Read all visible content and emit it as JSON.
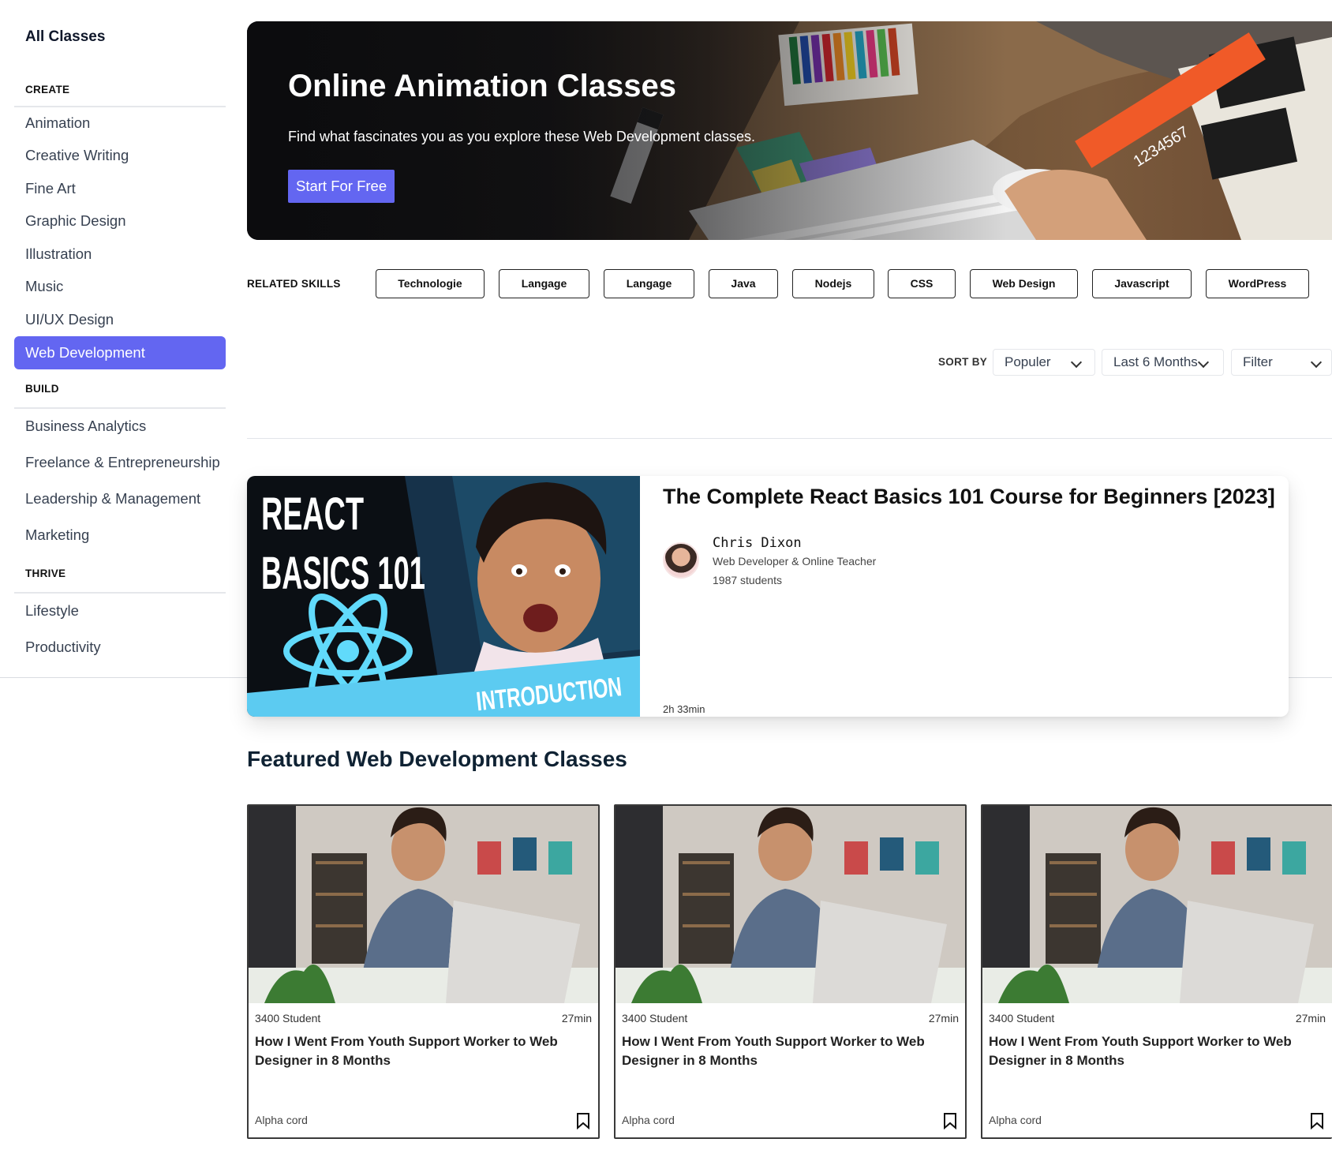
{
  "sidebar": {
    "title": "All Classes",
    "sections": {
      "create": "CREATE",
      "build": "BUILD",
      "thrive": "THRIVE"
    },
    "create_items": [
      "Animation",
      "Creative Writing",
      "Fine Art",
      "Graphic Design",
      "Illustration",
      "Music",
      "UI/UX Design",
      "Web Development"
    ],
    "build_items": [
      "Business Analytics",
      "Freelance & Entrepreneurship",
      "Leadership & Management",
      "Marketing"
    ],
    "thrive_items": [
      "Lifestyle",
      "Productivity"
    ],
    "active_item": "Web Development"
  },
  "hero": {
    "title": "Online Animation Classes",
    "subtitle": "Find what fascinates you as you explore these Web Development classes.",
    "button": "Start For Free",
    "ruler_text": "1234567"
  },
  "related_skills": {
    "label": "RELATED SKILLS",
    "chips": [
      "Technologie",
      "Langage",
      "Langage",
      "Java",
      "Nodejs",
      "CSS",
      "Web Design",
      "Javascript",
      "WordPress"
    ]
  },
  "sort": {
    "label": "SORT BY",
    "sort_value": "Populer",
    "period_value": "Last 6 Months",
    "filter_value": "Filter"
  },
  "featured_course": {
    "thumb_line1": "REACT",
    "thumb_line2": "BASICS 101",
    "thumb_banner": "INTRODUCTION",
    "title": "The Complete React Basics 101 Course for Beginners [2023]",
    "instructor_name": "Chris Dixon",
    "instructor_role": "Web Developer & Online Teacher",
    "students": "1987 students",
    "duration": "2h 33min"
  },
  "featured_section": {
    "title": "Featured Web Development Classes",
    "cards": [
      {
        "students": "3400 Student",
        "duration": "27min",
        "title": "How I Went From Youth Support Worker to Web Designer in 8 Months",
        "author": "Alpha cord"
      },
      {
        "students": "3400 Student",
        "duration": "27min",
        "title": "How I Went From Youth Support Worker to Web Designer in 8 Months",
        "author": "Alpha cord"
      },
      {
        "students": "3400 Student",
        "duration": "27min",
        "title": "How I Went From Youth Support Worker to Web Designer in 8 Months",
        "author": "Alpha cord"
      }
    ]
  },
  "colors": {
    "accent": "#6366f1",
    "thumb_banner": "#5ccbf1",
    "react_logo": "#61dafb"
  }
}
